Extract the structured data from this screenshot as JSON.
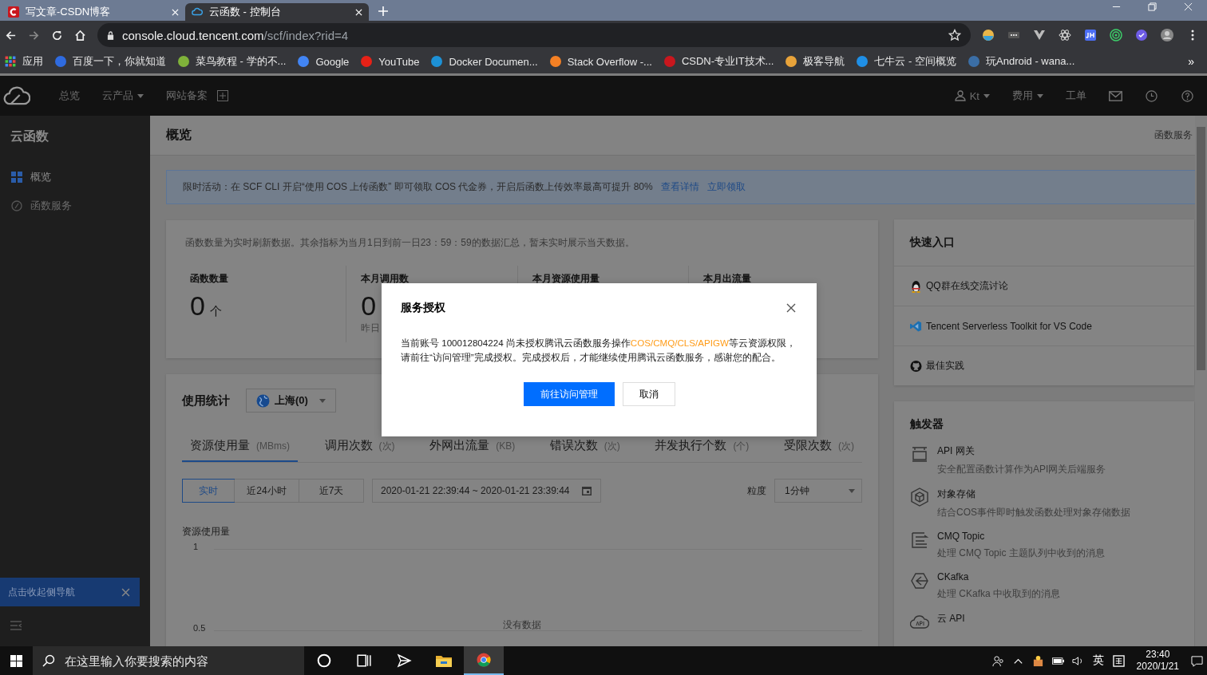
{
  "browser": {
    "tabs": [
      {
        "title": "写文章-CSDN博客",
        "kind": "csdn",
        "selected": false
      },
      {
        "title": "云函数 - 控制台",
        "kind": "cloud",
        "selected": true
      }
    ],
    "url": {
      "host": "console.cloud.tencent.com",
      "path": "/scf/index?rid=4"
    },
    "apps": "应用",
    "bookmarks": [
      {
        "label": "百度一下，你就知道",
        "color": "#2f6be0"
      },
      {
        "label": "菜鸟教程 - 学的不...",
        "color": "#7fb23a"
      },
      {
        "label": "Google",
        "color": "#4285f4"
      },
      {
        "label": "YouTube",
        "color": "#e62117"
      },
      {
        "label": "Docker Documen...",
        "color": "#1d91d6"
      },
      {
        "label": "Stack Overflow -...",
        "color": "#f48024"
      },
      {
        "label": "CSDN-专业IT技术...",
        "color": "#c9171e"
      },
      {
        "label": "极客导航",
        "color": "#e8a33a"
      },
      {
        "label": "七牛云 - 空间概览",
        "color": "#1f8fe6"
      },
      {
        "label": "玩Android - wana...",
        "color": "#3b6ea5"
      }
    ],
    "more": "»"
  },
  "console_nav": {
    "items": [
      {
        "label": "总览",
        "dropdown": false
      },
      {
        "label": "云产品",
        "dropdown": true
      },
      {
        "label": "网站备案",
        "dropdown": false
      }
    ],
    "right": [
      {
        "label": "Kt",
        "kind": "user"
      },
      {
        "label": "费用",
        "kind": "menu"
      },
      {
        "label": "工单",
        "kind": "text"
      }
    ]
  },
  "sidebar": {
    "title": "云函数",
    "items": [
      {
        "label": "概览",
        "kind": "grid",
        "selected": true
      },
      {
        "label": "函数服务",
        "kind": "circle",
        "selected": false
      }
    ],
    "collapse_tip": "点击收起侧导航"
  },
  "page": {
    "title": "概览",
    "top_right": "函数服务",
    "notice": {
      "text": "限时活动：在 SCF CLI 开启“使用 COS 上传函数” 即可领取 COS 代金券，开启后函数上传效率最高可提升 80%",
      "links": [
        "查看详情",
        "立即领取"
      ]
    },
    "stats": {
      "note": "函数数量为实时刷新数据。其余指标为当月1日到前一日23：59：59的数据汇总，暂未实时展示当天数据。",
      "metrics": [
        {
          "label": "函数数量",
          "value": "0",
          "unit": "个"
        },
        {
          "label": "本月调用数",
          "value": "0",
          "sub": "昨日"
        },
        {
          "label": "本月资源使用量"
        },
        {
          "label": "本月出流量"
        }
      ]
    },
    "usage": {
      "title": "使用统计",
      "region": "上海(0)",
      "tabs": [
        {
          "label": "资源使用量",
          "unit": "(MBms)",
          "selected": true
        },
        {
          "label": "调用次数",
          "unit": "(次)",
          "selected": false
        },
        {
          "label": "外网出流量",
          "unit": "(KB)",
          "selected": false
        },
        {
          "label": "错误次数",
          "unit": "(次)",
          "selected": false
        },
        {
          "label": "并发执行个数",
          "unit": "(个)",
          "selected": false
        },
        {
          "label": "受限次数",
          "unit": "(次)",
          "selected": false
        }
      ],
      "ranges": [
        {
          "label": "实时",
          "selected": true
        },
        {
          "label": "近24小时",
          "selected": false
        },
        {
          "label": "近7天",
          "selected": false
        }
      ],
      "date_range": "2020-01-21 22:39:44 ~ 2020-01-21 23:39:44",
      "granularity_label": "粒度",
      "granularity": "1分钟",
      "chart": {
        "title": "资源使用量",
        "y_labels": [
          "1",
          "0.5"
        ],
        "empty_text": "没有数据"
      }
    }
  },
  "quick_entry": {
    "title": "快速入口",
    "items": [
      {
        "label": "QQ群在线交流讨论",
        "kind": "qq"
      },
      {
        "label": "Tencent Serverless Toolkit for VS Code",
        "kind": "vscode"
      },
      {
        "label": "最佳实践",
        "kind": "github"
      }
    ]
  },
  "triggers": {
    "title": "触发器",
    "items": [
      {
        "name": "API 网关",
        "desc": "安全配置函数计算作为API网关后端服务",
        "kind": "api"
      },
      {
        "name": "对象存储",
        "desc": "结合COS事件即时触发函数处理对象存储数据",
        "kind": "cube"
      },
      {
        "name": "CMQ Topic",
        "desc": "处理 CMQ Topic 主题队列中收到的消息",
        "kind": "queue"
      },
      {
        "name": "CKafka",
        "desc": "处理 CKafka 中收取到的消息",
        "kind": "kafka"
      },
      {
        "name": "云 API",
        "kind": "cloudapi"
      }
    ]
  },
  "dialog": {
    "title": "服务授权",
    "text_before": "当前账号 100012804224 尚未授权腾讯云函数服务操作",
    "highlight": "COS/CMQ/CLS/APIGW",
    "text_after": "等云资源权限，请前往“访问管理”完成授权。完成授权后，才能继续使用腾讯云函数服务，感谢您的配合。",
    "primary": "前往访问管理",
    "secondary": "取消"
  },
  "taskbar": {
    "search": {
      "placeholder": "在这里输入你要搜索的内容"
    },
    "ime": "英",
    "time": "23:40",
    "date": "2020/1/21"
  }
}
